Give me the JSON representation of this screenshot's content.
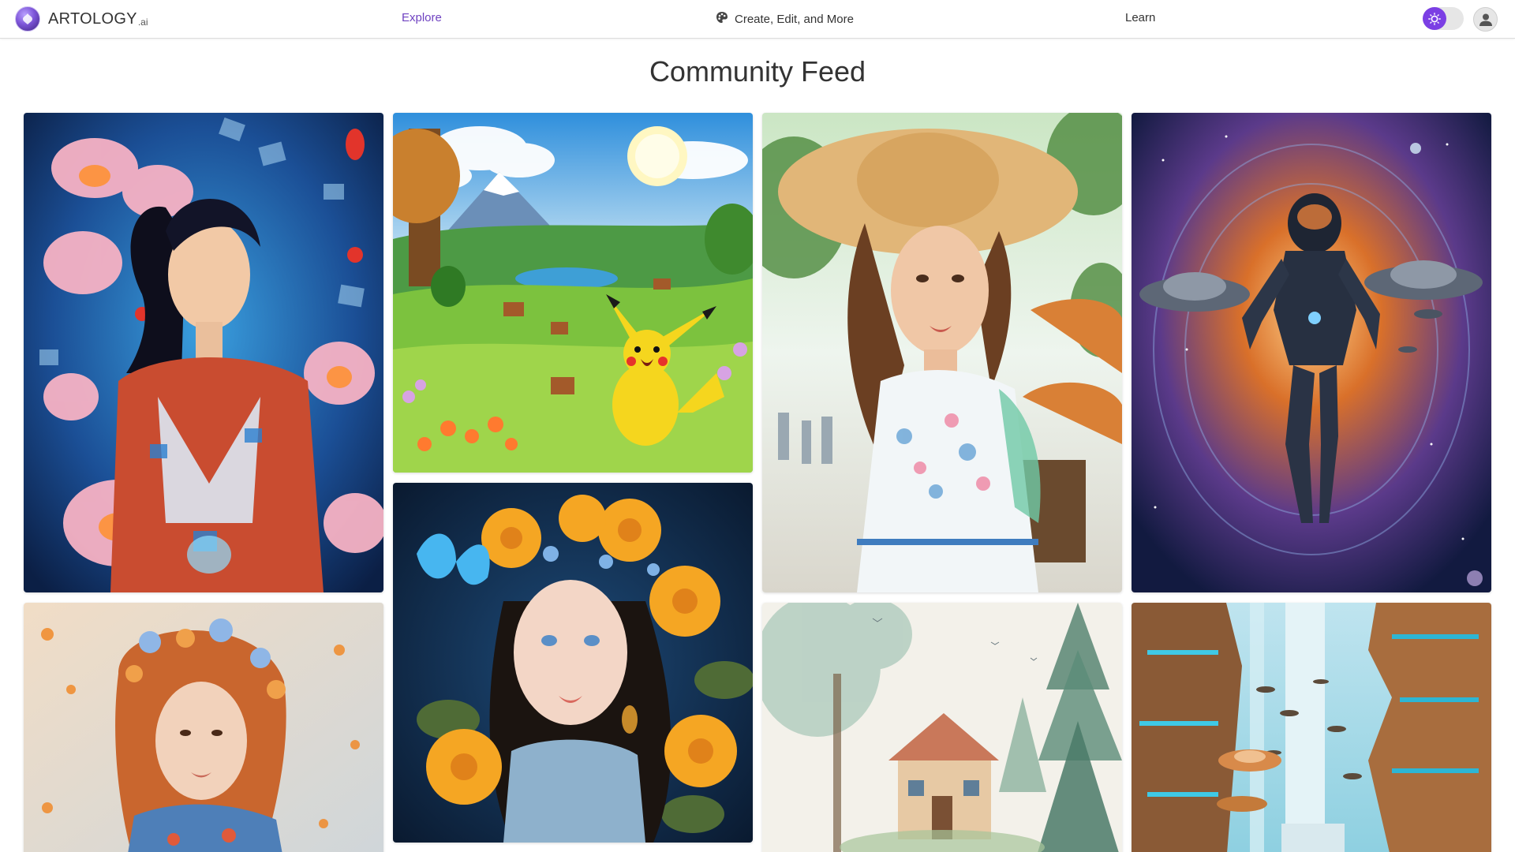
{
  "brand": {
    "name": "ARTOLOGY",
    "suffix": ".ai"
  },
  "nav": {
    "explore": "Explore",
    "create": "Create, Edit, and More",
    "learn": "Learn"
  },
  "icons": {
    "brand": "artology-logo-icon",
    "create": "palette-icon",
    "theme": "sun-icon",
    "user": "user-avatar-icon"
  },
  "colors": {
    "accent": "#6f42c1",
    "toggle": "#7b3fe4"
  },
  "page": {
    "title": "Community Feed"
  }
}
